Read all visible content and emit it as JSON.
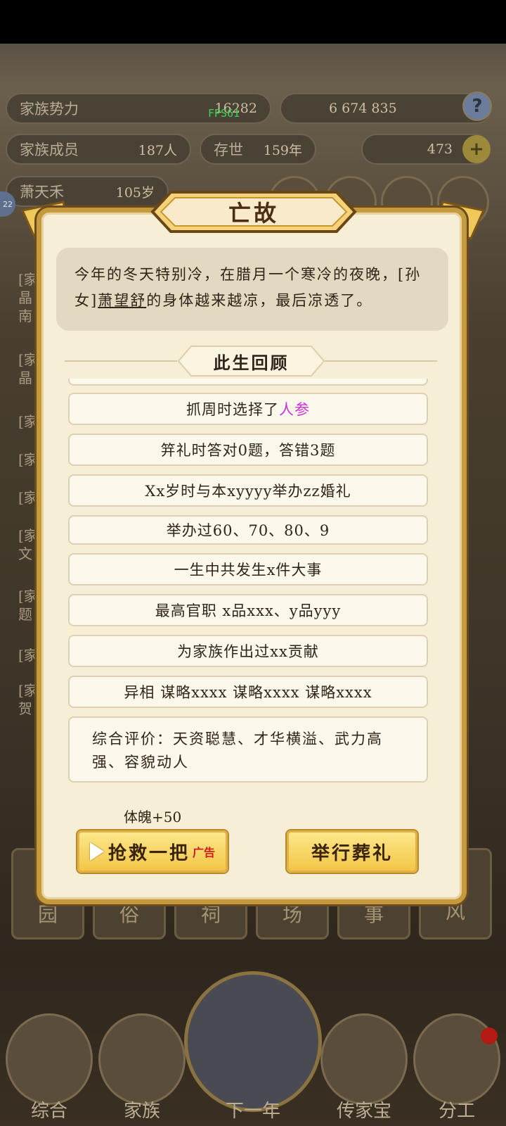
{
  "top": {
    "family_power_label": "家族势力",
    "family_power_value": "16282",
    "fps": "FPS61",
    "resources": "6 674 835",
    "members_label": "家族成员",
    "members_value": "187人",
    "existence_label": "存世",
    "existence_value": "159年",
    "gold_value": "473",
    "person_name": "萧天禾",
    "person_age": "105岁",
    "level_badge": "22"
  },
  "side_left": [
    "[家",
    "晶",
    "南",
    "[家",
    "晶",
    "[家",
    "[家",
    "[家",
    "[家",
    "文",
    "[家",
    "题",
    "[家",
    "[家",
    "贺"
  ],
  "modal": {
    "title": "亡故",
    "description_1": "今年的冬天特别冷，在腊月一个寒冷的夜晚，[孙女]",
    "description_name": "萧望舒",
    "description_2": "的身体越来越凉，最后凉透了。",
    "section_title": "此生回顾",
    "rows": {
      "zhuazhou_prefix": "抓周时选择了",
      "zhuazhou_item": "人参",
      "jili": "笄礼时答对0题，答错3题",
      "marriage": "Xx岁时与本xyyyy举办zz婚礼",
      "hosted": "举办过60、70、80、9",
      "events": "一生中共发生x件大事",
      "rank": "最高官职 x品xxx、y品yyy",
      "contribution": "为家族作出过xx贡献",
      "traits": "异相 谋略xxxx 谋略xxxx 谋略xxxx"
    },
    "summary": "综合评价：天资聪慧、才华横溢、武力高强、容貌动人",
    "bonus": "体魄+50",
    "rescue_label": "抢救一把",
    "rescue_ad": "广告",
    "funeral_label": "举行葬礼"
  },
  "nav_cards": [
    "园",
    "俗",
    "祠",
    "场",
    "事",
    "家\n风"
  ],
  "bottom_nav": [
    "综合",
    "家族",
    "下一年",
    "传家宝",
    "分工"
  ]
}
